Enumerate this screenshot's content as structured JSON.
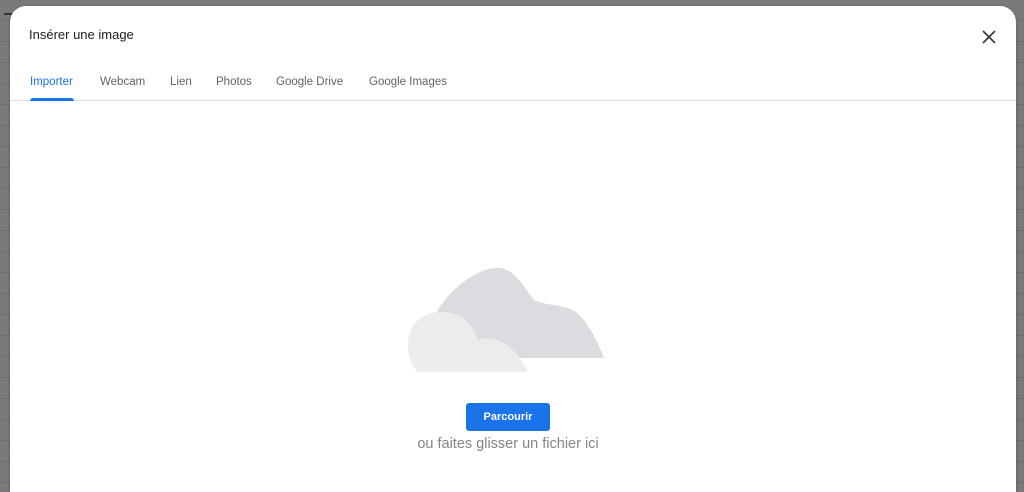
{
  "dialog": {
    "title": "Insérer une image",
    "close_icon": "close-icon"
  },
  "tabs": [
    {
      "label": "Importer",
      "active": true
    },
    {
      "label": "Webcam",
      "active": false
    },
    {
      "label": "Lien",
      "active": false
    },
    {
      "label": "Photos",
      "active": false
    },
    {
      "label": "Google Drive",
      "active": false
    },
    {
      "label": "Google Images",
      "active": false
    }
  ],
  "upload": {
    "illustration": "cloud-illustration",
    "button_label": "Parcourir",
    "hint": "ou faites glisser un fichier ici"
  },
  "colors": {
    "accent": "#1a73e8",
    "tab_inactive": "#5f6368",
    "cloud_back": "#dadce0",
    "cloud_front": "#ececee"
  }
}
